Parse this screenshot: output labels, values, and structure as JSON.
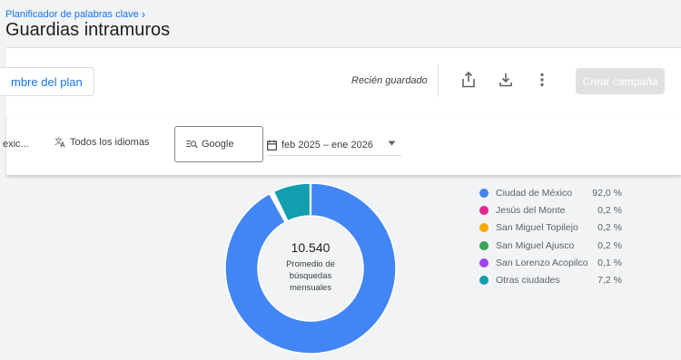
{
  "header": {
    "breadcrumb": "Planificador de palabras clave",
    "title": "Guardias intramuros"
  },
  "toolbar": {
    "plan_name_label": "mbre del plan",
    "saved_status": "Recién guardado",
    "share_icon": "share-icon",
    "download_icon": "download-icon",
    "more_icon": "more-vert-icon",
    "create_campaign_label": "Crear campaña"
  },
  "filters": {
    "location": "exic...",
    "language": "Todos los idiomas",
    "network": "Google",
    "date_range": "feb 2025 – ene 2026"
  },
  "donut": {
    "value": "10.540",
    "label": "Promedio de búsquedas mensuales"
  },
  "chart_data": {
    "type": "pie",
    "title": "",
    "center_value": "10.540",
    "center_label": "Promedio de búsquedas mensuales",
    "series": [
      {
        "name": "Ciudad de México",
        "value": 92.0,
        "label": "92,0 %",
        "color": "#4285f4"
      },
      {
        "name": "Jesús del Monte",
        "value": 0.2,
        "label": "0,2 %",
        "color": "#e52592"
      },
      {
        "name": "San Miguel Topilejo",
        "value": 0.2,
        "label": "0,2 %",
        "color": "#f9ab00"
      },
      {
        "name": "San Miguel Ajusco",
        "value": 0.2,
        "label": "0,2 %",
        "color": "#34a853"
      },
      {
        "name": "San Lorenzo Acopilco",
        "value": 0.1,
        "label": "0,1 %",
        "color": "#a142f4"
      },
      {
        "name": "Otras ciudades",
        "value": 7.2,
        "label": "7,2 %",
        "color": "#129eaf"
      }
    ],
    "legend_position": "right"
  }
}
